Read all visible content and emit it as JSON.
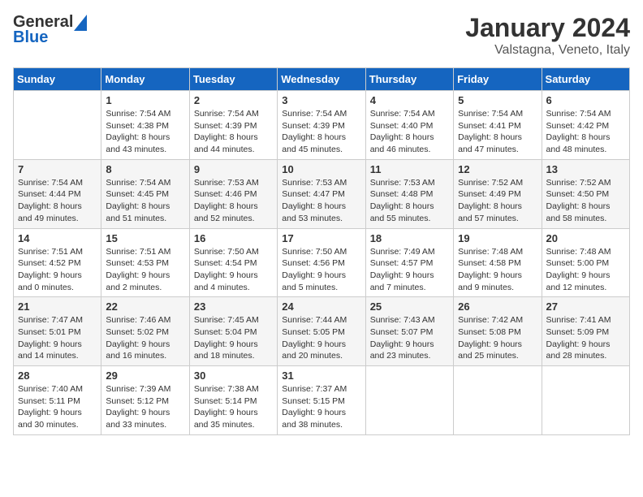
{
  "logo": {
    "general": "General",
    "blue": "Blue"
  },
  "title": "January 2024",
  "location": "Valstagna, Veneto, Italy",
  "weekdays": [
    "Sunday",
    "Monday",
    "Tuesday",
    "Wednesday",
    "Thursday",
    "Friday",
    "Saturday"
  ],
  "weeks": [
    [
      {
        "day": "",
        "sunrise": "",
        "sunset": "",
        "daylight": ""
      },
      {
        "day": "1",
        "sunrise": "Sunrise: 7:54 AM",
        "sunset": "Sunset: 4:38 PM",
        "daylight": "Daylight: 8 hours and 43 minutes."
      },
      {
        "day": "2",
        "sunrise": "Sunrise: 7:54 AM",
        "sunset": "Sunset: 4:39 PM",
        "daylight": "Daylight: 8 hours and 44 minutes."
      },
      {
        "day": "3",
        "sunrise": "Sunrise: 7:54 AM",
        "sunset": "Sunset: 4:39 PM",
        "daylight": "Daylight: 8 hours and 45 minutes."
      },
      {
        "day": "4",
        "sunrise": "Sunrise: 7:54 AM",
        "sunset": "Sunset: 4:40 PM",
        "daylight": "Daylight: 8 hours and 46 minutes."
      },
      {
        "day": "5",
        "sunrise": "Sunrise: 7:54 AM",
        "sunset": "Sunset: 4:41 PM",
        "daylight": "Daylight: 8 hours and 47 minutes."
      },
      {
        "day": "6",
        "sunrise": "Sunrise: 7:54 AM",
        "sunset": "Sunset: 4:42 PM",
        "daylight": "Daylight: 8 hours and 48 minutes."
      }
    ],
    [
      {
        "day": "7",
        "sunrise": "Sunrise: 7:54 AM",
        "sunset": "Sunset: 4:44 PM",
        "daylight": "Daylight: 8 hours and 49 minutes."
      },
      {
        "day": "8",
        "sunrise": "Sunrise: 7:54 AM",
        "sunset": "Sunset: 4:45 PM",
        "daylight": "Daylight: 8 hours and 51 minutes."
      },
      {
        "day": "9",
        "sunrise": "Sunrise: 7:53 AM",
        "sunset": "Sunset: 4:46 PM",
        "daylight": "Daylight: 8 hours and 52 minutes."
      },
      {
        "day": "10",
        "sunrise": "Sunrise: 7:53 AM",
        "sunset": "Sunset: 4:47 PM",
        "daylight": "Daylight: 8 hours and 53 minutes."
      },
      {
        "day": "11",
        "sunrise": "Sunrise: 7:53 AM",
        "sunset": "Sunset: 4:48 PM",
        "daylight": "Daylight: 8 hours and 55 minutes."
      },
      {
        "day": "12",
        "sunrise": "Sunrise: 7:52 AM",
        "sunset": "Sunset: 4:49 PM",
        "daylight": "Daylight: 8 hours and 57 minutes."
      },
      {
        "day": "13",
        "sunrise": "Sunrise: 7:52 AM",
        "sunset": "Sunset: 4:50 PM",
        "daylight": "Daylight: 8 hours and 58 minutes."
      }
    ],
    [
      {
        "day": "14",
        "sunrise": "Sunrise: 7:51 AM",
        "sunset": "Sunset: 4:52 PM",
        "daylight": "Daylight: 9 hours and 0 minutes."
      },
      {
        "day": "15",
        "sunrise": "Sunrise: 7:51 AM",
        "sunset": "Sunset: 4:53 PM",
        "daylight": "Daylight: 9 hours and 2 minutes."
      },
      {
        "day": "16",
        "sunrise": "Sunrise: 7:50 AM",
        "sunset": "Sunset: 4:54 PM",
        "daylight": "Daylight: 9 hours and 4 minutes."
      },
      {
        "day": "17",
        "sunrise": "Sunrise: 7:50 AM",
        "sunset": "Sunset: 4:56 PM",
        "daylight": "Daylight: 9 hours and 5 minutes."
      },
      {
        "day": "18",
        "sunrise": "Sunrise: 7:49 AM",
        "sunset": "Sunset: 4:57 PM",
        "daylight": "Daylight: 9 hours and 7 minutes."
      },
      {
        "day": "19",
        "sunrise": "Sunrise: 7:48 AM",
        "sunset": "Sunset: 4:58 PM",
        "daylight": "Daylight: 9 hours and 9 minutes."
      },
      {
        "day": "20",
        "sunrise": "Sunrise: 7:48 AM",
        "sunset": "Sunset: 5:00 PM",
        "daylight": "Daylight: 9 hours and 12 minutes."
      }
    ],
    [
      {
        "day": "21",
        "sunrise": "Sunrise: 7:47 AM",
        "sunset": "Sunset: 5:01 PM",
        "daylight": "Daylight: 9 hours and 14 minutes."
      },
      {
        "day": "22",
        "sunrise": "Sunrise: 7:46 AM",
        "sunset": "Sunset: 5:02 PM",
        "daylight": "Daylight: 9 hours and 16 minutes."
      },
      {
        "day": "23",
        "sunrise": "Sunrise: 7:45 AM",
        "sunset": "Sunset: 5:04 PM",
        "daylight": "Daylight: 9 hours and 18 minutes."
      },
      {
        "day": "24",
        "sunrise": "Sunrise: 7:44 AM",
        "sunset": "Sunset: 5:05 PM",
        "daylight": "Daylight: 9 hours and 20 minutes."
      },
      {
        "day": "25",
        "sunrise": "Sunrise: 7:43 AM",
        "sunset": "Sunset: 5:07 PM",
        "daylight": "Daylight: 9 hours and 23 minutes."
      },
      {
        "day": "26",
        "sunrise": "Sunrise: 7:42 AM",
        "sunset": "Sunset: 5:08 PM",
        "daylight": "Daylight: 9 hours and 25 minutes."
      },
      {
        "day": "27",
        "sunrise": "Sunrise: 7:41 AM",
        "sunset": "Sunset: 5:09 PM",
        "daylight": "Daylight: 9 hours and 28 minutes."
      }
    ],
    [
      {
        "day": "28",
        "sunrise": "Sunrise: 7:40 AM",
        "sunset": "Sunset: 5:11 PM",
        "daylight": "Daylight: 9 hours and 30 minutes."
      },
      {
        "day": "29",
        "sunrise": "Sunrise: 7:39 AM",
        "sunset": "Sunset: 5:12 PM",
        "daylight": "Daylight: 9 hours and 33 minutes."
      },
      {
        "day": "30",
        "sunrise": "Sunrise: 7:38 AM",
        "sunset": "Sunset: 5:14 PM",
        "daylight": "Daylight: 9 hours and 35 minutes."
      },
      {
        "day": "31",
        "sunrise": "Sunrise: 7:37 AM",
        "sunset": "Sunset: 5:15 PM",
        "daylight": "Daylight: 9 hours and 38 minutes."
      },
      {
        "day": "",
        "sunrise": "",
        "sunset": "",
        "daylight": ""
      },
      {
        "day": "",
        "sunrise": "",
        "sunset": "",
        "daylight": ""
      },
      {
        "day": "",
        "sunrise": "",
        "sunset": "",
        "daylight": ""
      }
    ]
  ]
}
